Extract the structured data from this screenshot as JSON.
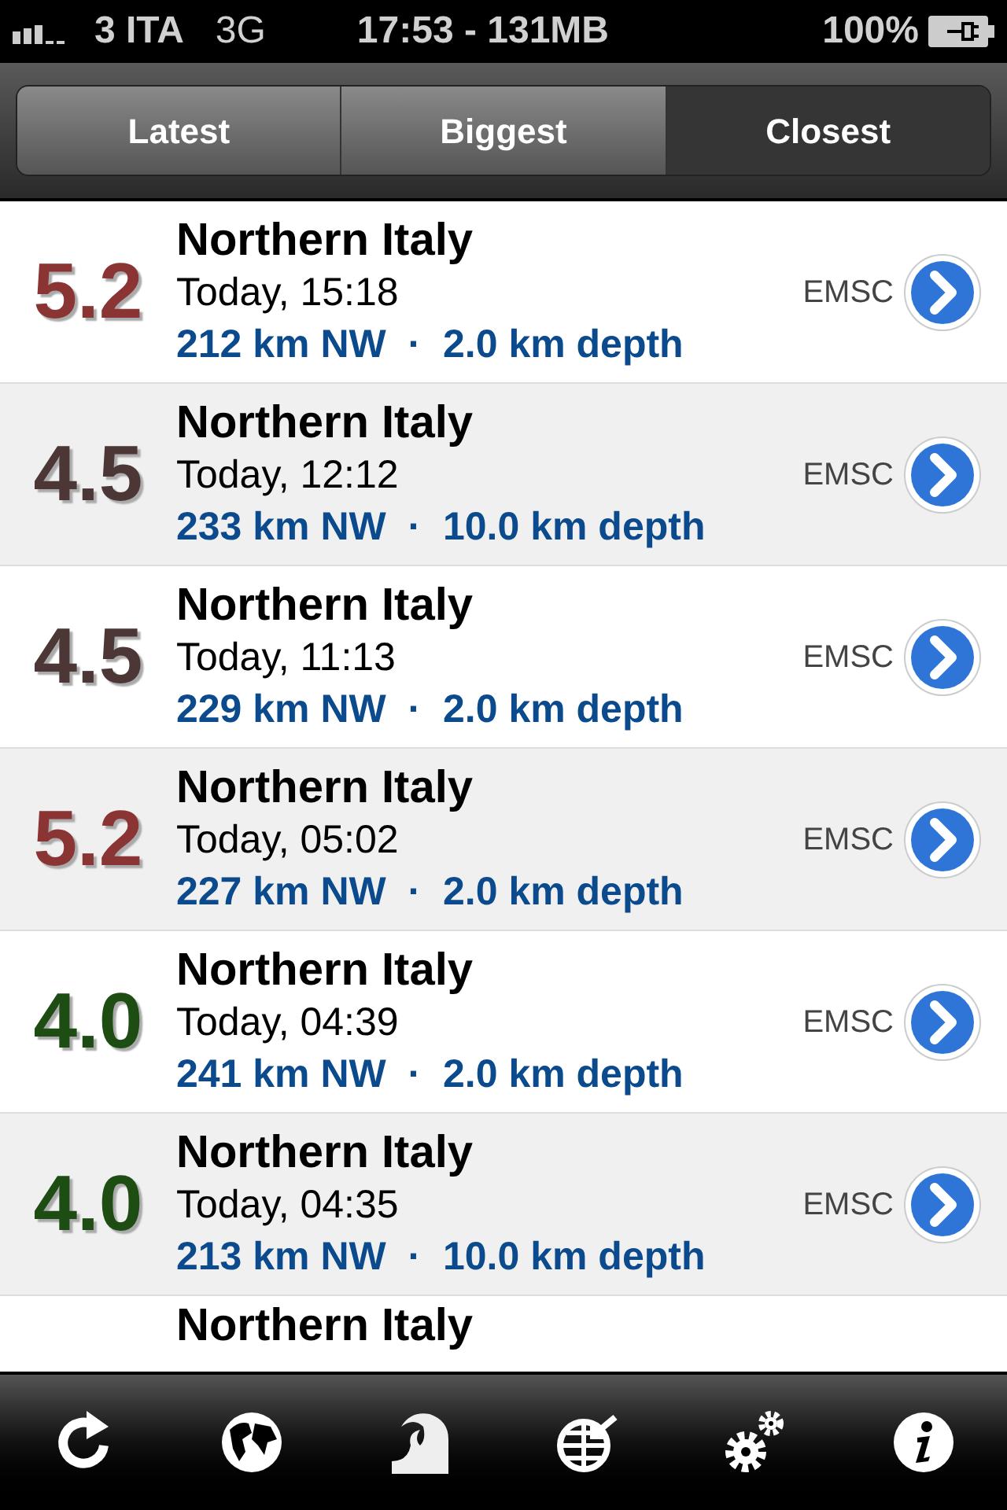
{
  "status_bar": {
    "carrier": "3 ITA",
    "network": "3G",
    "time": "17:53 - 131MB",
    "battery": "100%"
  },
  "tabs": [
    {
      "label": "Latest",
      "selected": false
    },
    {
      "label": "Biggest",
      "selected": false
    },
    {
      "label": "Closest",
      "selected": true
    }
  ],
  "quakes": [
    {
      "magnitude": "5.2",
      "color": "#8b3434",
      "place": "Northern Italy",
      "time": "Today, 15:18",
      "distance": "212 km NW  ·  2.0 km depth",
      "source": "EMSC"
    },
    {
      "magnitude": "4.5",
      "color": "#4d3636",
      "place": "Northern Italy",
      "time": "Today, 12:12",
      "distance": "233 km NW  ·  10.0 km depth",
      "source": "EMSC"
    },
    {
      "magnitude": "4.5",
      "color": "#4d3636",
      "place": "Northern Italy",
      "time": "Today, 11:13",
      "distance": "229 km NW  ·  2.0 km depth",
      "source": "EMSC"
    },
    {
      "magnitude": "5.2",
      "color": "#8b3434",
      "place": "Northern Italy",
      "time": "Today, 05:02",
      "distance": "227 km NW  ·  2.0 km depth",
      "source": "EMSC"
    },
    {
      "magnitude": "4.0",
      "color": "#1e4d14",
      "place": "Northern Italy",
      "time": "Today, 04:39",
      "distance": "241 km NW  ·  2.0 km depth",
      "source": "EMSC"
    },
    {
      "magnitude": "4.0",
      "color": "#1e4d14",
      "place": "Northern Italy",
      "time": "Today, 04:35",
      "distance": "213 km NW  ·  10.0 km depth",
      "source": "EMSC"
    },
    {
      "place": "Northern Italy"
    }
  ],
  "toolbar": [
    {
      "kind": "refresh"
    },
    {
      "kind": "globe"
    },
    {
      "kind": "wave"
    },
    {
      "kind": "locate"
    },
    {
      "kind": "settings"
    },
    {
      "kind": "info"
    }
  ]
}
